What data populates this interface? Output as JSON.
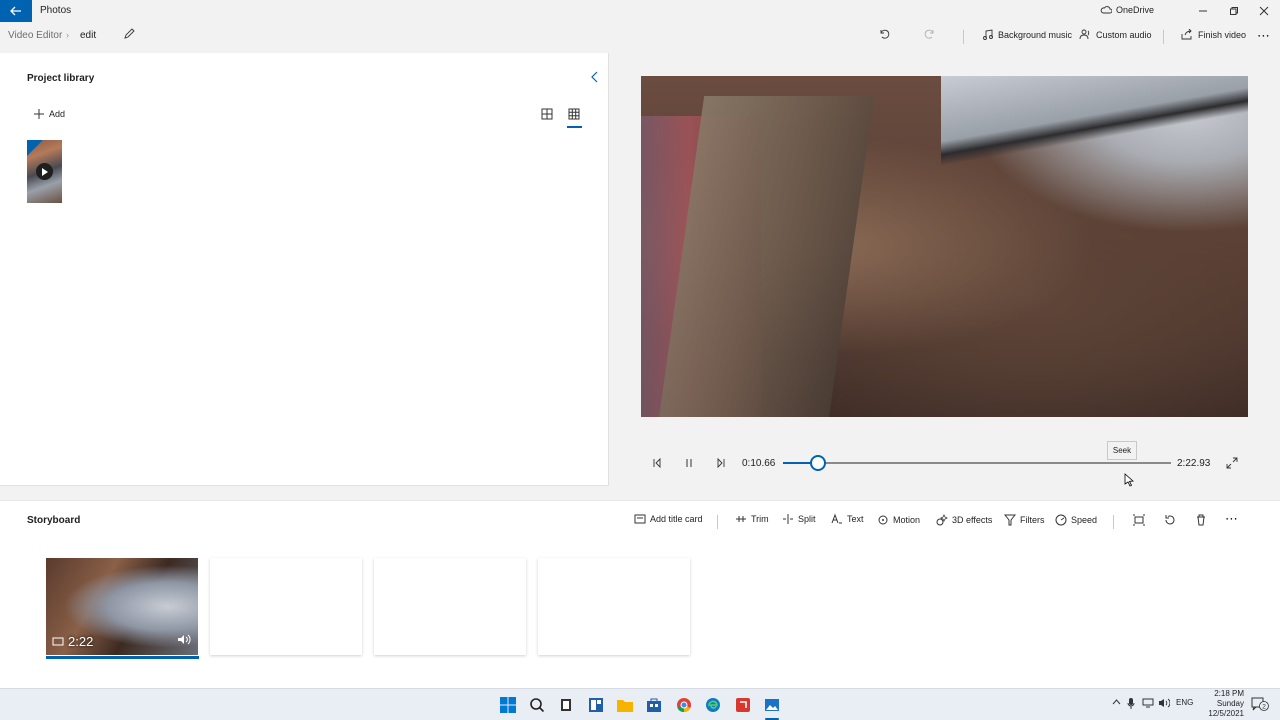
{
  "window": {
    "app_title": "Photos",
    "onedrive_label": "OneDrive"
  },
  "breadcrumb": {
    "root": "Video Editor",
    "current": "edit"
  },
  "toolbar": {
    "background_music": "Background music",
    "custom_audio": "Custom audio",
    "finish_video": "Finish video"
  },
  "library": {
    "title": "Project library",
    "add_label": "Add"
  },
  "player": {
    "current_time": "0:10.66",
    "total_time": "2:22.93",
    "progress_fraction": 0.09,
    "seek_tooltip": "Seek"
  },
  "storyboard": {
    "title": "Storyboard",
    "tools": {
      "add_title_card": "Add title card",
      "trim": "Trim",
      "split": "Split",
      "text": "Text",
      "motion": "Motion",
      "effects_3d": "3D effects",
      "filters": "Filters",
      "speed": "Speed"
    },
    "clip_duration": "2:22"
  },
  "taskbar": {
    "language": "ENG",
    "time": "2:18 PM",
    "day": "Sunday",
    "date": "12/5/2021",
    "notification_count": "2"
  },
  "colors": {
    "accent": "#0063b1",
    "panel": "#ffffff",
    "chrome": "#f2f2f2"
  }
}
